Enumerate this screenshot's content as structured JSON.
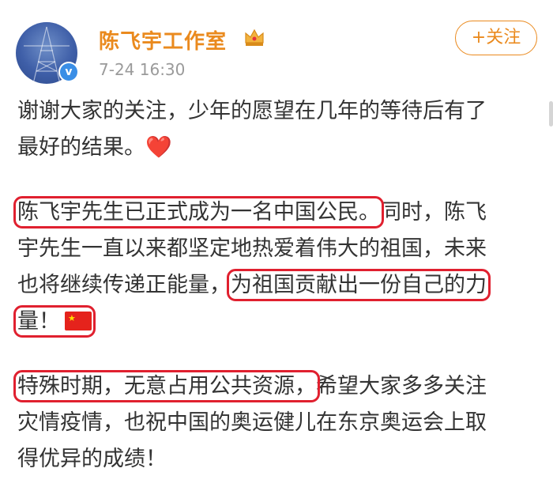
{
  "post": {
    "author": "陈飞宇工作室",
    "time": "7-24 16:30",
    "follow_label": "+关注",
    "verified_badge": "v",
    "paragraphs": {
      "p1": {
        "line1": "谢谢大家的关注，少年的愿望在几年的等待后有了",
        "line2": "最好的结果。",
        "emoji_heart": "❤️"
      },
      "p2": {
        "hl1": "陈飞宇先生已正式成为一名中国公民。",
        "after_hl1": "同时，陈飞",
        "line2": "宇先生一直以来都坚定地热爱着伟大的祖国，未来",
        "line3_pre": "也将继续传递正能量，",
        "hl2_part1": "为祖国贡献出一份自己的力",
        "hl2_part2": "量！",
        "emoji_flag": "🇨🇳"
      },
      "p3": {
        "hl3": "特殊时期，无意占用公共资源，",
        "after_hl3": "希望大家多多关注",
        "line2": "灾情疫情，也祝中国的奥运健儿在东京奥运会上取",
        "line3": "得优异的成绩！"
      }
    }
  },
  "colors": {
    "accent": "#ea8a1e",
    "highlight_box": "#e0202f",
    "verified": "#3a8ee6"
  },
  "icons": {
    "crown": "crown-icon",
    "verified": "verified-icon",
    "heart": "heart-icon",
    "flag": "china-flag-icon"
  }
}
